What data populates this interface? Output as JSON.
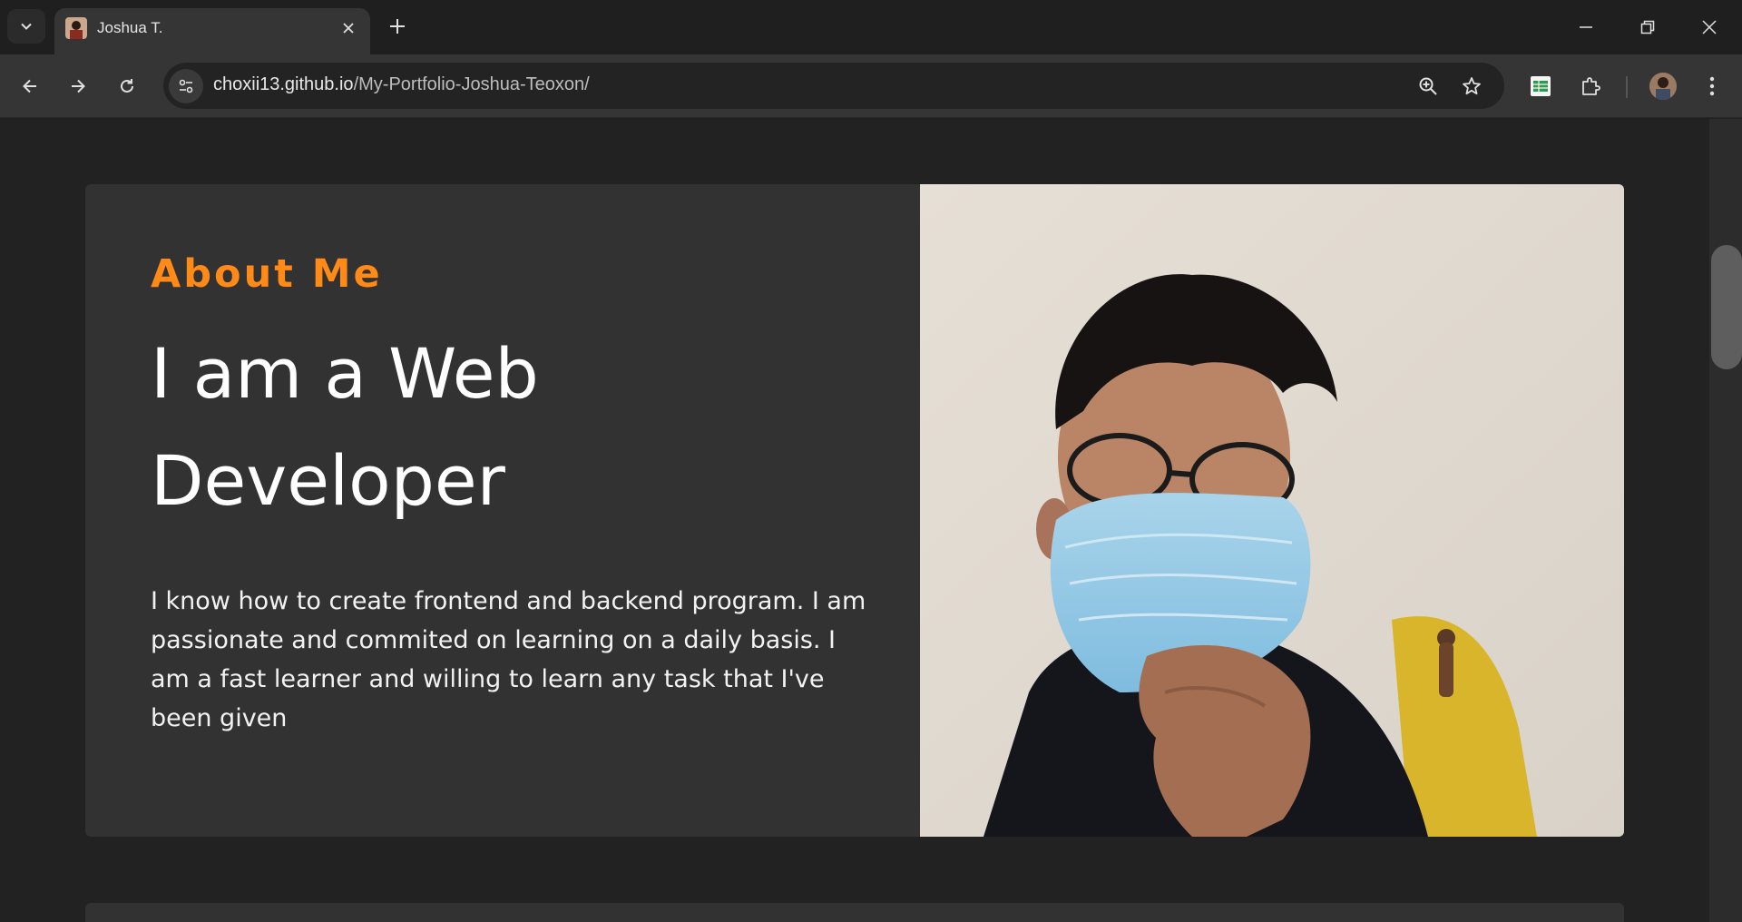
{
  "browser": {
    "tab": {
      "title": "Joshua T.",
      "favicon": "portrait-favicon"
    },
    "url": {
      "host": "choxii13.github.io",
      "path": "/My-Portfolio-Joshua-Teoxon/"
    },
    "icons": {
      "tab_search": "chevron-down-icon",
      "tab_close": "close-icon",
      "new_tab": "plus-icon",
      "minimize": "minimize-icon",
      "restore": "restore-icon",
      "close_window": "close-icon",
      "back": "arrow-left-icon",
      "forward": "arrow-right-icon",
      "reload": "reload-icon",
      "site_info": "tune-icon",
      "zoom": "zoom-in-icon",
      "bookmark": "star-icon",
      "extension_sheets": "sheets-icon",
      "extensions": "puzzle-icon",
      "menu": "kebab-menu-icon"
    },
    "colors": {
      "accent": "#ff8a17",
      "chrome": "#353535",
      "page_bg": "#222222",
      "card_bg": "#323232"
    }
  },
  "about": {
    "eyebrow": "About Me",
    "headline_line1": "I am a Web",
    "headline_line2": "Developer",
    "bio": "I know how to create frontend and backend program. I am passionate and commited on learning on a daily basis. I am a fast learner and willing to learn any task that I've been given",
    "photo": "portrait-photo"
  }
}
